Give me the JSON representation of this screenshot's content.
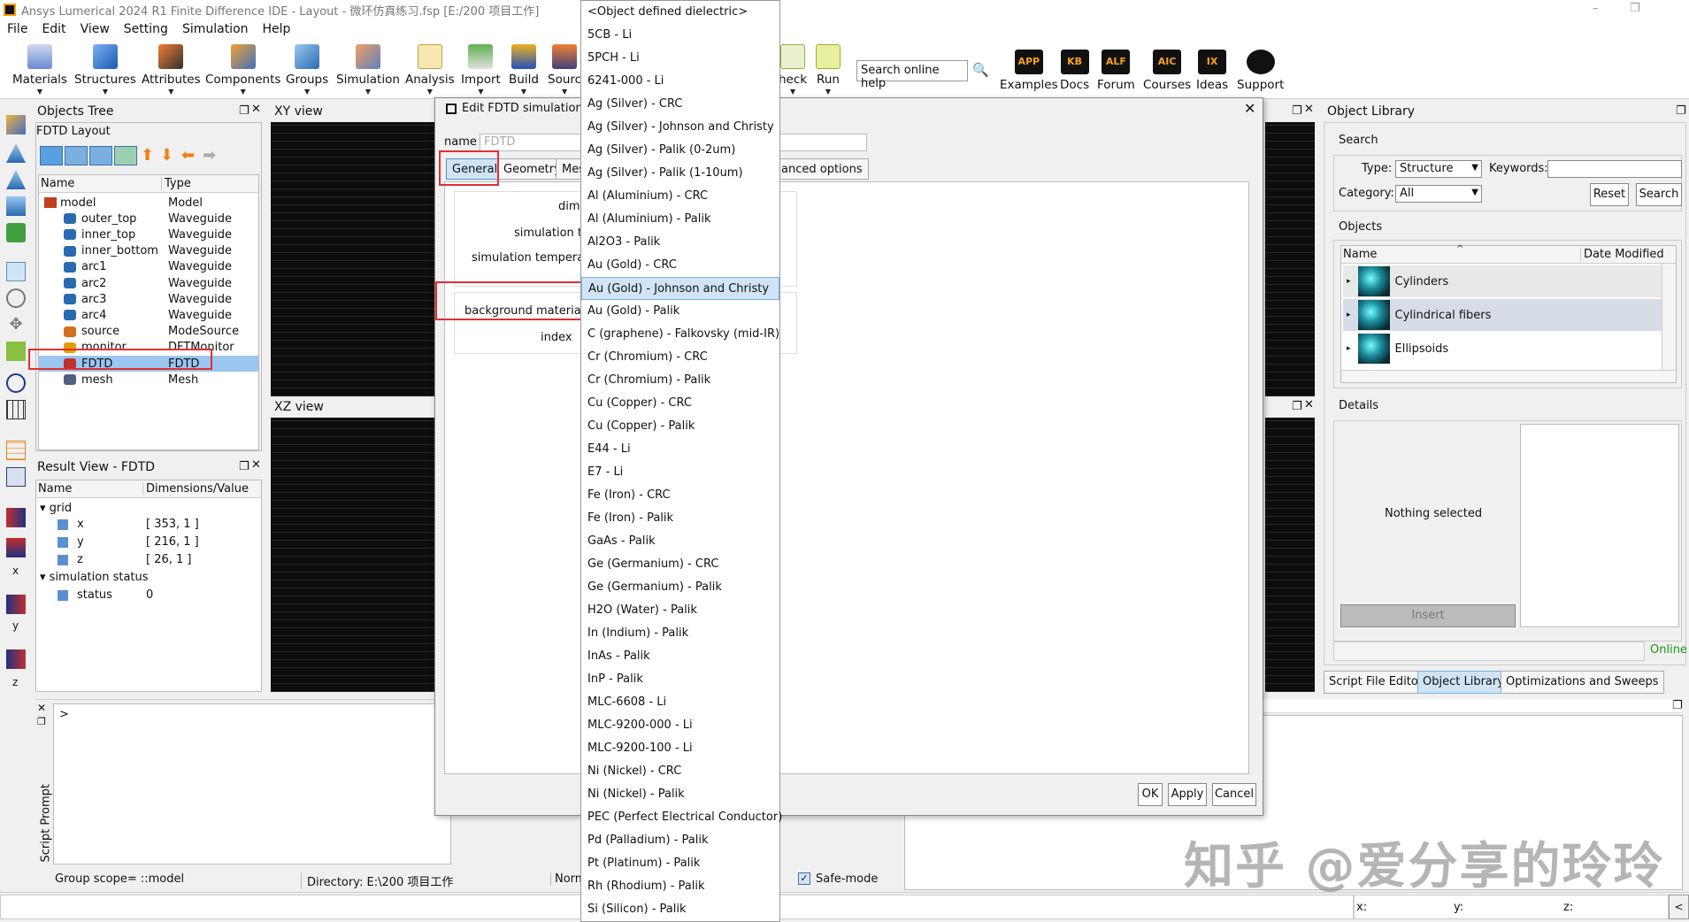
{
  "window": {
    "title": "Ansys Lumerical 2024 R1 Finite Difference IDE - Layout - 微环仿真练习.fsp [E:/200 项目工作]",
    "minimize": "–",
    "restore": "❐"
  },
  "menu": [
    "File",
    "Edit",
    "View",
    "Setting",
    "Simulation",
    "Help"
  ],
  "toolbar": {
    "items": [
      "Materials",
      "Structures",
      "Attributes",
      "Components",
      "Groups",
      "Simulation",
      "Analysis",
      "Import",
      "Build",
      "Sourc",
      "heck",
      "Run"
    ],
    "search_help": "Search online help",
    "resources": [
      {
        "label": "Examples",
        "badge": "APP"
      },
      {
        "label": "Docs",
        "badge": "KB"
      },
      {
        "label": "Forum",
        "badge": "ALF"
      },
      {
        "label": "Courses",
        "badge": "AIC"
      },
      {
        "label": "Ideas",
        "badge": "IX"
      },
      {
        "label": "Support",
        "badge": ""
      }
    ]
  },
  "objects_tree": {
    "title": "Objects Tree",
    "subtitle": "FDTD Layout",
    "col_name": "Name",
    "col_type": "Type",
    "rows": [
      {
        "name": "model",
        "type": "Model"
      },
      {
        "name": "outer_top",
        "type": "Waveguide"
      },
      {
        "name": "inner_top",
        "type": "Waveguide"
      },
      {
        "name": "inner_bottom",
        "type": "Waveguide"
      },
      {
        "name": "arc1",
        "type": "Waveguide"
      },
      {
        "name": "arc2",
        "type": "Waveguide"
      },
      {
        "name": "arc3",
        "type": "Waveguide"
      },
      {
        "name": "arc4",
        "type": "Waveguide"
      },
      {
        "name": "source",
        "type": "ModeSource"
      },
      {
        "name": "monitor",
        "type": "DFTMonitor"
      },
      {
        "name": "FDTD",
        "type": "FDTD"
      },
      {
        "name": "mesh",
        "type": "Mesh"
      }
    ]
  },
  "result_view": {
    "title": "Result View - FDTD",
    "col_name": "Name",
    "col_value": "Dimensions/Value",
    "group_grid": "grid",
    "x_label": "x",
    "x_value": "[ 353, 1 ]",
    "y_label": "y",
    "y_value": "[ 216, 1 ]",
    "z_label": "z",
    "z_value": "[ 26, 1 ]",
    "group_status": "simulation status",
    "status_label": "status",
    "status_value": "0"
  },
  "views": {
    "xy": "XY view",
    "xz": "XZ view"
  },
  "axis_labels": {
    "x": "x",
    "y": "y",
    "z": "z"
  },
  "script": {
    "label": "Script Prompt",
    "prompt": ">",
    "group_scope": "Group scope= ::model",
    "directory": "Directory: E:\\200 项目工作",
    "norm": "Norm",
    "safe_mode": "Safe-mode"
  },
  "status_coords": {
    "x": "x:",
    "y": "y:",
    "z": "z:"
  },
  "dialog": {
    "title": "Edit FDTD simulation",
    "name_label": "name",
    "name_value": "FDTD",
    "tabs": [
      "General",
      "Geometry",
      "Mes",
      "anced options"
    ],
    "fields": [
      "dim",
      "simulation t",
      "simulation tempera",
      "background material",
      "index"
    ],
    "ok": "OK",
    "apply": "Apply",
    "cancel": "Cancel",
    "close": "✕"
  },
  "material_list": [
    "<Object defined dielectric>",
    "5CB - Li",
    "5PCH - Li",
    "6241-000 - Li",
    "Ag (Silver) - CRC",
    "Ag (Silver) - Johnson and Christy",
    "Ag (Silver) - Palik (0-2um)",
    "Ag (Silver) - Palik (1-10um)",
    "Al (Aluminium) - CRC",
    "Al (Aluminium) - Palik",
    "Al2O3 - Palik",
    "Au (Gold) - CRC",
    "Au (Gold) - Johnson and Christy",
    "Au (Gold) - Palik",
    "C (graphene) - Falkovsky (mid-IR)",
    "Cr (Chromium) - CRC",
    "Cr (Chromium) - Palik",
    "Cu (Copper) - CRC",
    "Cu (Copper) - Palik",
    "E44 - Li",
    "E7 - Li",
    "Fe (Iron) - CRC",
    "Fe (Iron) - Palik",
    "GaAs - Palik",
    "Ge (Germanium) - CRC",
    "Ge (Germanium) - Palik",
    "H2O (Water) - Palik",
    "In (Indium) - Palik",
    "InAs - Palik",
    "InP - Palik",
    "MLC-6608 - Li",
    "MLC-9200-000 - Li",
    "MLC-9200-100 - Li",
    "Ni (Nickel) - CRC",
    "Ni (Nickel) - Palik",
    "PEC (Perfect Electrical Conductor)",
    "Pd (Palladium) - Palik",
    "Pt (Platinum) - Palik",
    "Rh (Rhodium) - Palik",
    "Si (Silicon) - Palik"
  ],
  "material_selected": "Au (Gold) - Johnson and Christy",
  "object_library": {
    "title": "Object Library",
    "search_label": "Search",
    "type_label": "Type:",
    "type_value": "Structure",
    "keywords_label": "Keywords:",
    "category_label": "Category:",
    "category_value": "All",
    "reset": "Reset",
    "search": "Search",
    "objects_label": "Objects",
    "col_name": "Name",
    "col_date": "Date Modified",
    "items": [
      "Cylinders",
      "Cylindrical fibers",
      "Ellipsoids"
    ],
    "details_label": "Details",
    "nothing_selected": "Nothing selected",
    "insert": "Insert",
    "online": "Online"
  },
  "bottom_tabs": [
    "Script File Editor",
    "Object Library",
    "Optimizations and Sweeps"
  ],
  "watermark": "知乎 @爱分享的玲玲",
  "colors": {
    "selection": "#cfe4f7",
    "highlight_box": "#e03030",
    "online": "#1a9a1a"
  }
}
